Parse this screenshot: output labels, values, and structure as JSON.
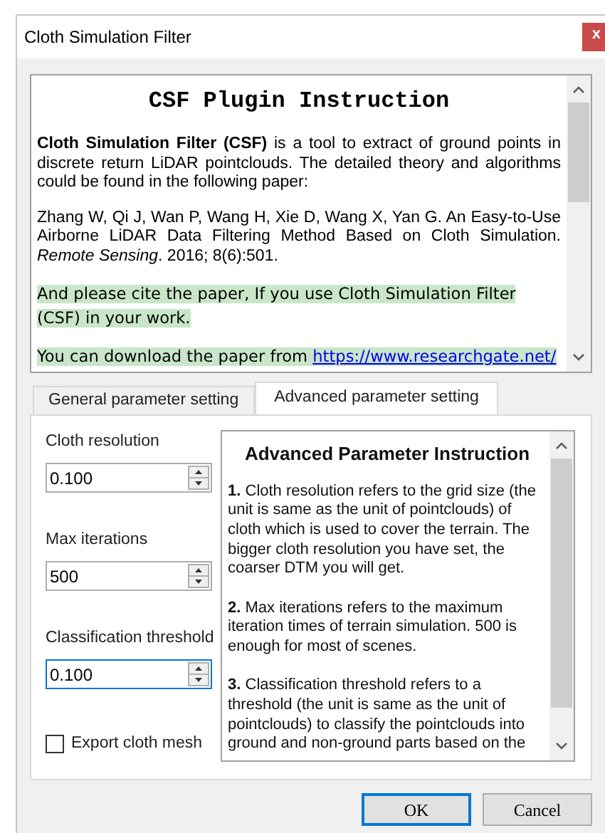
{
  "window": {
    "title": "Cloth Simulation Filter",
    "close_label": "x"
  },
  "instruction": {
    "heading": "CSF Plugin Instruction",
    "paragraphs": [
      {
        "kind": "text",
        "text": "**Cloth Simulation Filter (CSF)** is a tool to extract of ground points in discrete return LiDAR pointclouds. The detailed theory and algorithms could be found in the following paper:"
      },
      {
        "kind": "text",
        "text": "Zhang W, Qi J, Wan P, Wang H, Xie D, Wang X, Yan G. An Easy-to-Use Airborne LiDAR Data Filtering Method Based on Cloth Simulation. *Remote Sensing*. 2016; 8(6):501."
      },
      {
        "kind": "highlight",
        "text": "And please cite the paper, If you use Cloth Simulation Filter (CSF) in your work."
      },
      {
        "kind": "link",
        "text": "You can download the paper from ",
        "link": "https://www.researchgate.net/"
      }
    ]
  },
  "tabs": [
    {
      "label": "General parameter setting",
      "selected": false
    },
    {
      "label": "Advanced parameter setting",
      "selected": true
    }
  ],
  "fields": [
    {
      "label": "Cloth resolution",
      "value": "0.100",
      "focused": false
    },
    {
      "label": "Max iterations",
      "value": "500",
      "focused": false
    },
    {
      "label": "Classification threshold",
      "value": "0.100",
      "focused": true
    }
  ],
  "export_mesh": {
    "label": "Export cloth mesh",
    "checked": false
  },
  "advanced": {
    "heading": "Advanced Parameter Instruction",
    "items": [
      {
        "number": "1.",
        "text": "Cloth resolution refers to the grid size (the unit is same as the unit of pointclouds) of cloth which is used to cover the terrain. The bigger cloth resolution you have set, the coarser DTM  you will get."
      },
      {
        "number": "2.",
        "text": "Max iterations refers to the maximum iteration times of terrain simulation. 500 is enough for most of scenes."
      },
      {
        "number": "3.",
        "text": "Classification threshold refers to a threshold (the unit is same as the unit of pointclouds) to classify the pointclouds into ground and non-ground parts based on the"
      }
    ]
  },
  "buttons": [
    {
      "label": "OK",
      "default": true
    },
    {
      "label": "Cancel",
      "default": false
    }
  ]
}
